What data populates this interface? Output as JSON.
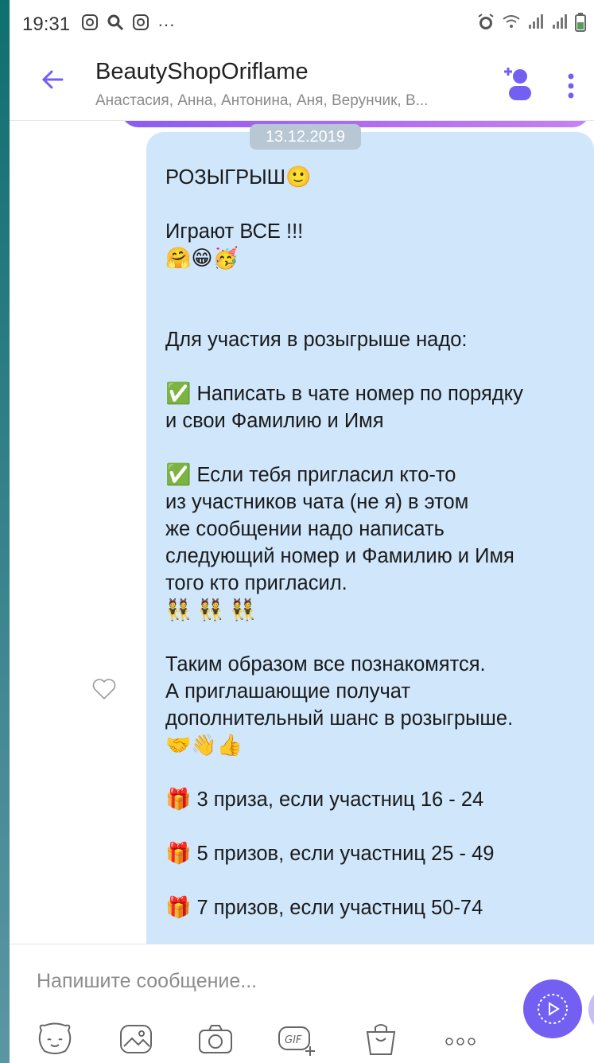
{
  "status_bar": {
    "time": "19:31",
    "left_icons": [
      "instagram-icon",
      "search-icon",
      "instagram-icon",
      "more-dots-icon"
    ],
    "right_icons": [
      "alarm-icon",
      "wifi-icon",
      "signal-icon",
      "signal-icon",
      "battery-icon"
    ]
  },
  "header": {
    "title": "BeautyShopOriflame",
    "subtitle": "Анастасия, Анна, Антонина, Аня, Верунчик, В...",
    "accent_color": "#7360f2"
  },
  "chat": {
    "date_chip": "13.12.2019",
    "message": {
      "title": "РОЗЫГРЫШ",
      "title_emoji": "🙂",
      "line_play": "Играют ВСЕ !!!",
      "play_emojis": "🤗😁🥳",
      "intro": "Для участия в розыгрыше надо:",
      "rule1_line1": "Написать в чате номер по порядку",
      "rule1_line2": "и свои Фамилию и Имя",
      "rule2_line1": "Если тебя пригласил кто-то",
      "rule2_line2": "из участников чата (не я) в этом",
      "rule2_line3": "же сообщении надо написать",
      "rule2_line4": "следующий номер и Фамилию и Имя",
      "rule2_line5": "того кто пригласил.",
      "bunny_emojis": "👯 👯 👯",
      "outro_line1": "Таким образом все познакомятся.",
      "outro_line2": "А приглашающие получат",
      "outro_line3": "дополнительный шанс в розыгрыше.",
      "outro_emojis": "🤝👋👍",
      "prize1": "3 приза, если участниц 16 - 24",
      "prize2": "5 призов, если участниц  25 - 49",
      "prize3": "7 призов, если участниц 50-74",
      "check_emoji": "✅",
      "gift_emoji": "🎁"
    },
    "bubble_color": "#cfe6fb"
  },
  "composer": {
    "placeholder": "Напишите сообщение...",
    "toolbar_icons": [
      "sticker-icon",
      "gallery-icon",
      "camera-icon",
      "gif-icon",
      "shopping-bag-icon",
      "more-icon"
    ],
    "send_color": "#7360f2"
  }
}
